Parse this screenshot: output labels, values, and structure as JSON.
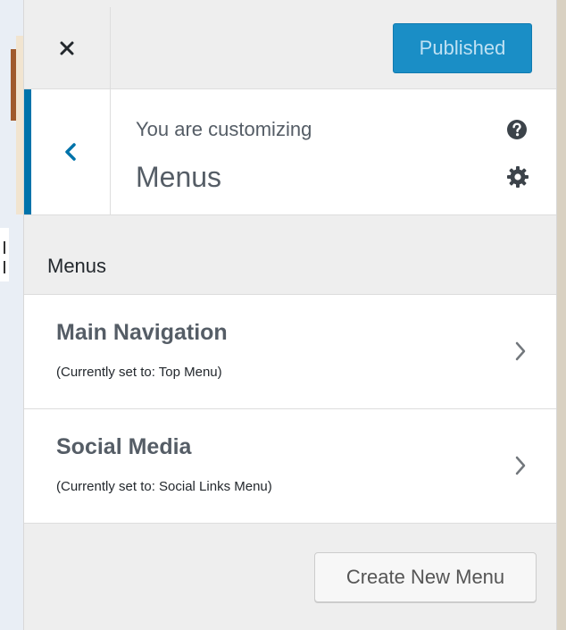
{
  "header": {
    "close_icon": "close-icon",
    "publish_label": "Published",
    "accent_color": "#1a8ec6"
  },
  "info": {
    "customizing_label": "You are customizing",
    "section_title": "Menus",
    "back_icon": "chevron-left-icon",
    "help_icon": "help-icon",
    "settings_icon": "gear-icon"
  },
  "menus": {
    "heading": "Menus",
    "items": [
      {
        "title": "Main Navigation",
        "subtitle": "(Currently set to: Top Menu)"
      },
      {
        "title": "Social Media",
        "subtitle": "(Currently set to: Social Links Menu)"
      }
    ],
    "create_label": "Create New Menu"
  }
}
